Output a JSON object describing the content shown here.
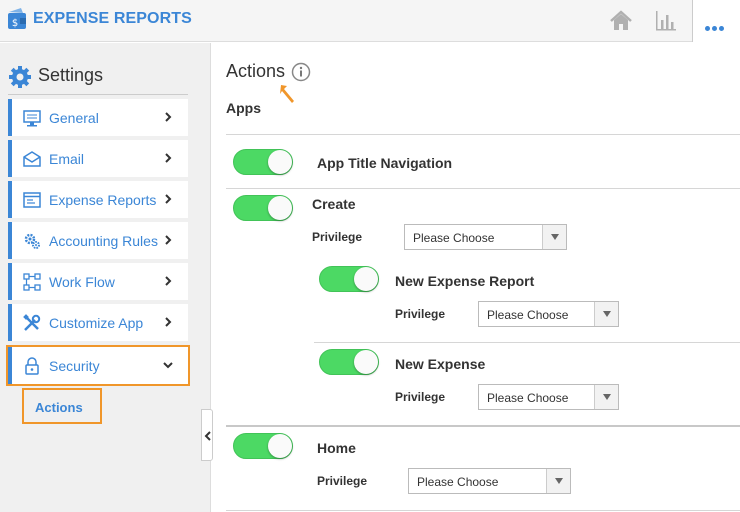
{
  "header": {
    "app_title": "EXPENSE REPORTS",
    "logo_icon": "wallet-dollar-icon",
    "icons": [
      "home-icon",
      "bar-chart-icon",
      "more-icon"
    ],
    "accent": "#3b86d6"
  },
  "sidebar": {
    "heading": "Settings",
    "items": [
      {
        "label": "General",
        "icon": "monitor-icon"
      },
      {
        "label": "Email",
        "icon": "envelope-icon"
      },
      {
        "label": "Expense Reports",
        "icon": "report-window-icon"
      },
      {
        "label": "Accounting Rules",
        "icon": "gears-icon"
      },
      {
        "label": "Work Flow",
        "icon": "workflow-icon"
      },
      {
        "label": "Customize App",
        "icon": "tools-icon"
      },
      {
        "label": "Security",
        "icon": "lock-icon",
        "expanded": true
      }
    ],
    "sub_item": "Actions",
    "highlight_color": "#f0962a"
  },
  "main": {
    "title": "Actions",
    "section": "Apps",
    "rows": [
      {
        "title": "App Title Navigation",
        "enabled": true
      },
      {
        "title": "Create",
        "enabled": true,
        "privilege_label": "Privilege",
        "privilege_value": "Please Choose"
      },
      {
        "title": "New Expense Report",
        "enabled": true,
        "privilege_label": "Privilege",
        "privilege_value": "Please Choose"
      },
      {
        "title": "New Expense",
        "enabled": true,
        "privilege_label": "Privilege",
        "privilege_value": "Please Choose"
      },
      {
        "title": "Home",
        "enabled": true,
        "privilege_label": "Privilege",
        "privilege_value": "Please Choose"
      }
    ],
    "toggle_color": "#4cd964"
  }
}
